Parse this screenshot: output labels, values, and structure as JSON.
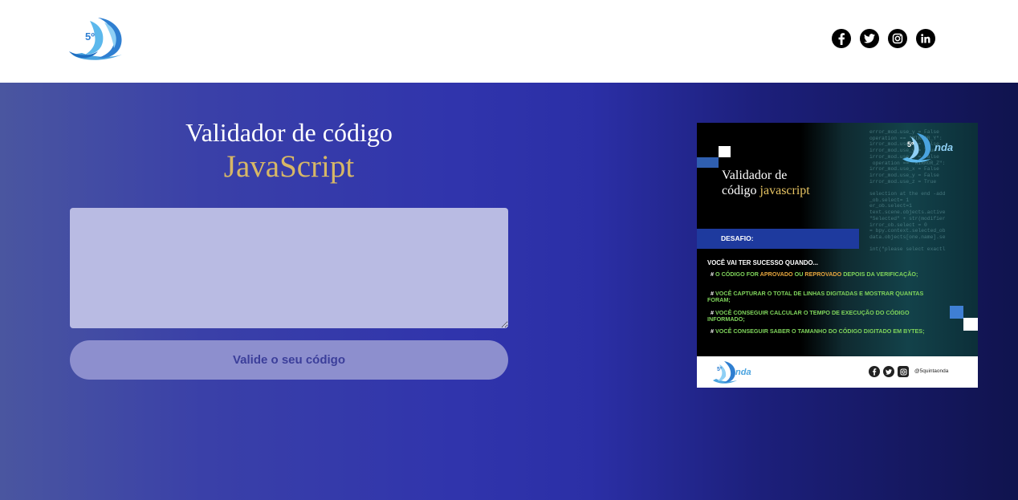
{
  "header": {
    "logo_icon": "wave-logo-icon",
    "logo_text": "5º",
    "social": [
      {
        "name": "facebook",
        "icon": "facebook-icon"
      },
      {
        "name": "twitter",
        "icon": "twitter-icon"
      },
      {
        "name": "instagram",
        "icon": "instagram-icon"
      },
      {
        "name": "linkedin",
        "icon": "linkedin-icon"
      }
    ]
  },
  "main": {
    "title_line1": "Validador de código",
    "title_line2": "JavaScript",
    "code_input": {
      "value": "",
      "placeholder": ""
    },
    "validate_button": "Valide o seu código"
  },
  "promo": {
    "title_part1": "Validador de",
    "title_part2": "código",
    "title_highlight": "javascript",
    "brand_text": "nda",
    "brand_number": "5º",
    "desafio": "DESAFIO:",
    "sucesso": "VOCÊ VAI TER SUCESSO QUANDO...",
    "items": [
      {
        "hash": "#",
        "a": "O CÓDIGO FOR",
        "b": "APROVADO",
        "c": "OU",
        "d": "REPROVADO",
        "e": "DEPOIS DA VERIFICAÇÃO;"
      },
      {
        "hash": "#",
        "text": "VOCÊ CAPTURAR O TOTAL DE LINHAS DIGITADAS E MOSTRAR QUANTAS FORAM;"
      },
      {
        "hash": "#",
        "text": "VOCÊ CONSEGUIR CALCULAR O TEMPO DE EXECUÇÃO DO CÓDIGO INFORMADO;"
      },
      {
        "hash": "#",
        "text": "VOCÊ CONSEGUIR SABER O TAMANHO DO CÓDIGO DIGITADO EM BYTES;"
      }
    ],
    "footer_handle": "@5quintaonda",
    "code_bg": "error_mod.use_y = False\noperation == \"MIRROR_Y\":\nirror_mod.use_x = False\nirror_mod.use_y = True\nirror_mod.use_z = False\n operation == \"MIRROR_Z\":\nirror_mod.use_x = False\nirror_mod.use_y = False\nirror_mod.use_z = True\n\nselection at the end -add\n_ob.select= 1\ner_ob.select=1\ntext.scene.objects.active\n\"Selected\" + str(modifier\nirror_ob.select = 0\n= bpy.context.selected_ob\ndata.objects[one.name].se\n\nint(\"please select exactl"
  },
  "colors": {
    "accent_gold": "#d7b766",
    "input_bg": "#b9bbe3",
    "button_bg": "#8d8fce",
    "button_text": "#3b3e9a"
  }
}
